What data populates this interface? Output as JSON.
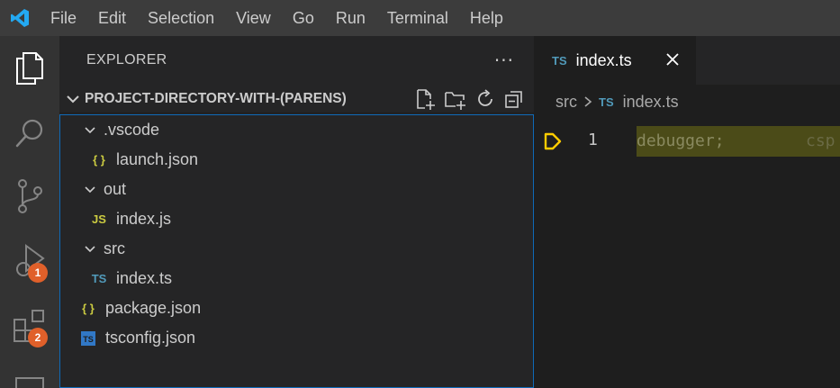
{
  "menu": [
    "File",
    "Edit",
    "Selection",
    "View",
    "Go",
    "Run",
    "Terminal",
    "Help"
  ],
  "activity": {
    "debug_badge": "1",
    "extensions_badge": "2"
  },
  "explorer": {
    "title": "EXPLORER",
    "more": "···",
    "section_title": "PROJECT-DIRECTORY-WITH-(PARENS)"
  },
  "tree": [
    {
      "label": ".vscode",
      "type": "folder"
    },
    {
      "label": "launch.json",
      "type": "json",
      "icon": "{ }"
    },
    {
      "label": "out",
      "type": "folder"
    },
    {
      "label": "index.js",
      "type": "js",
      "icon": "JS"
    },
    {
      "label": "src",
      "type": "folder"
    },
    {
      "label": "index.ts",
      "type": "ts",
      "icon": "TS"
    },
    {
      "label": "package.json",
      "type": "json",
      "icon": "{ }"
    },
    {
      "label": "tsconfig.json",
      "type": "tsconfig",
      "icon": "TS"
    }
  ],
  "editor": {
    "tab_icon": "TS",
    "tab_label": "index.ts",
    "breadcrumb_folder": "src",
    "breadcrumb_icon": "TS",
    "breadcrumb_file": "index.ts",
    "line_number": "1",
    "code": "debugger;",
    "ghost": "csp"
  },
  "colors": {
    "accent": "#0e6ab8",
    "badge": "#e0602a",
    "json_icon": "#cbcb41",
    "ts_icon": "#519aba",
    "breakpoint": "#ffcc00"
  }
}
